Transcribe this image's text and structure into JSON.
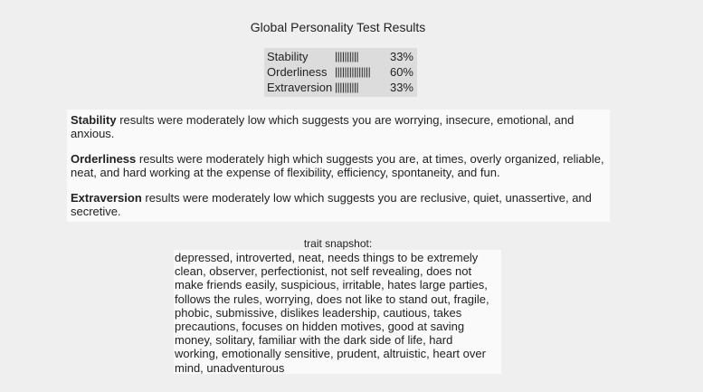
{
  "title": "Global Personality Test Results",
  "scores": [
    {
      "name": "Stability",
      "bar": "||||||||||",
      "percent": "33%",
      "value": 33
    },
    {
      "name": "Orderliness",
      "bar": "|||||||||||||||",
      "percent": "60%",
      "value": 60
    },
    {
      "name": "Extraversion",
      "bar": "||||||||||",
      "percent": "33%",
      "value": 33
    }
  ],
  "descriptions": [
    {
      "trait": "Stability",
      "text": " results were moderately low which suggests you are worrying, insecure, emotional, and anxious."
    },
    {
      "trait": "Orderliness",
      "text": " results were moderately high which suggests you are, at times, overly organized, reliable, neat, and hard working at the expense of flexibility, efficiency, spontaneity, and fun."
    },
    {
      "trait": "Extraversion",
      "text": " results were moderately low which suggests you are reclusive, quiet, unassertive, and secretive."
    }
  ],
  "snapshot": {
    "label": "trait snapshot:",
    "text": "depressed, introverted, neat, needs things to be extremely clean, observer, perfectionist, not self revealing, does not make friends easily, suspicious, irritable, hates large parties, follows the rules, worrying, does not like to stand out, fragile, phobic, submissive, dislikes leadership, cautious, takes precautions, focuses on hidden motives, good at saving money, solitary, familiar with the dark side of life, hard working, emotionally sensitive, prudent, altruistic, heart over mind, unadventurous"
  }
}
